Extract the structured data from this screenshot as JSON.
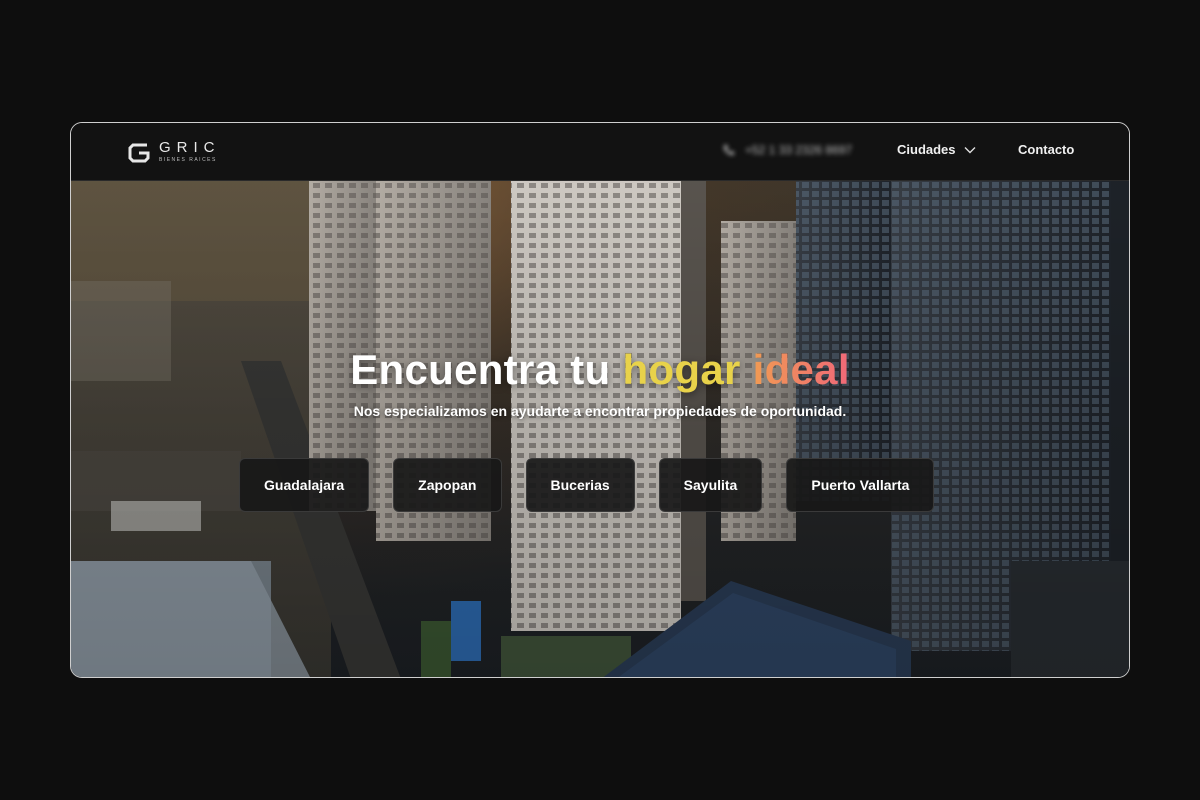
{
  "brand": {
    "name": "GRIC",
    "tagline": "BIENES RAICES"
  },
  "nav": {
    "phone": "+52 1 33 2326 8697",
    "cities_label": "Ciudades",
    "contact_label": "Contacto"
  },
  "hero": {
    "title_part1": "Encuentra tu ",
    "title_part2": "hogar",
    "title_part3": " ideal",
    "subtitle": "Nos especializamos en ayudarte a encontrar propiedades de oportunidad.",
    "cities": [
      "Guadalajara",
      "Zapopan",
      "Bucerias",
      "Sayulita",
      "Puerto Vallarta"
    ]
  },
  "colors": {
    "accent_yellow": "#e8d24a",
    "accent_gradient_start": "#f1a14e",
    "accent_gradient_end": "#f06878"
  }
}
